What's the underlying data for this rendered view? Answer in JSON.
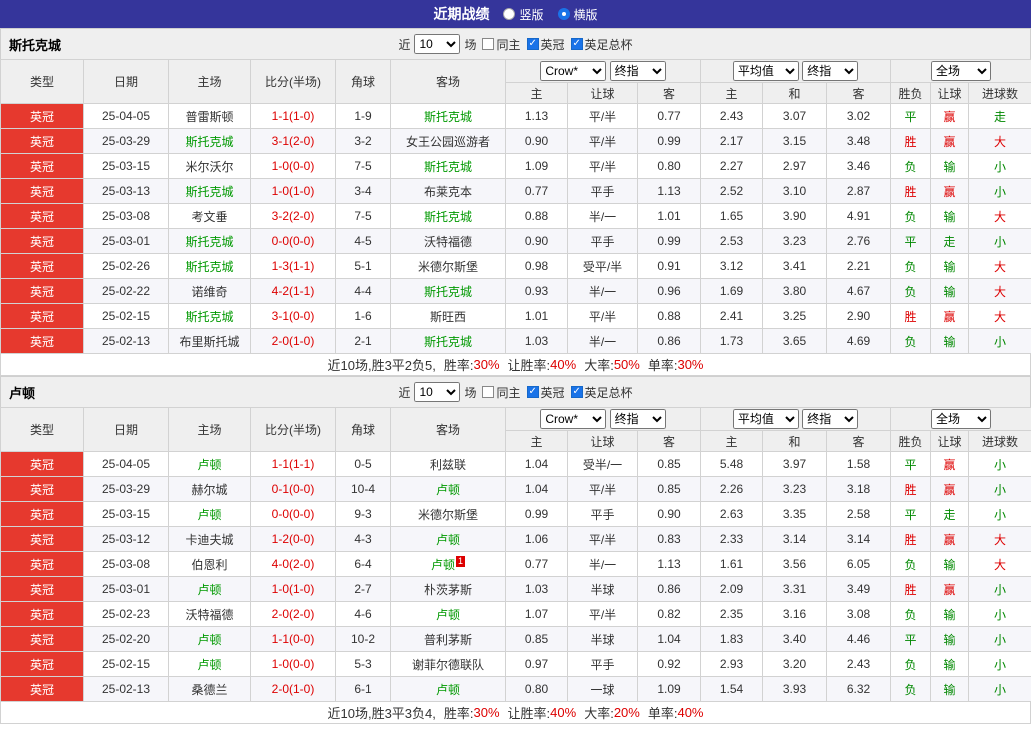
{
  "topbar": {
    "title": "近期战绩",
    "view_modes": [
      {
        "label": "竖版",
        "selected": false
      },
      {
        "label": "横版",
        "selected": true
      }
    ]
  },
  "columns": {
    "left": [
      "类型",
      "日期",
      "主场",
      "比分(半场)",
      "角球",
      "客场"
    ],
    "group1": {
      "bookmaker": "Crow*",
      "stage": "终指"
    },
    "group2": {
      "bookmaker": "平均值",
      "stage": "终指"
    },
    "group3": {
      "scope": "全场"
    },
    "sub": [
      "主",
      "让球",
      "客",
      "主",
      "和",
      "客",
      "胜负",
      "让球",
      "进球数"
    ]
  },
  "outcome_colors": {
    "胜": "red",
    "平": "green",
    "负": "green",
    "赢": "red",
    "输": "green",
    "走": "green",
    "大": "red",
    "小": "green"
  },
  "colors": {
    "red": "#dd0000",
    "green": "#008800",
    "badge_bg": "#e6392e",
    "topbar_bg": "#35359b",
    "accent_blue": "#1a73e8"
  },
  "sections": [
    {
      "team": "斯托克城",
      "controls": {
        "recent_label": "近",
        "count": "10",
        "unit_label": "场",
        "filters": [
          {
            "label": "同主",
            "checked": false
          },
          {
            "label": "英冠",
            "checked": true
          },
          {
            "label": "英足总杯",
            "checked": true
          }
        ]
      },
      "rows": [
        {
          "league": "英冠",
          "date": "25-04-05",
          "home": "普雷斯顿",
          "home_target": false,
          "score": "1-1(1-0)",
          "corners": "1-9",
          "away": "斯托克城",
          "away_target": true,
          "odds": [
            "1.13",
            "平/半",
            "0.77",
            "2.43",
            "3.07",
            "3.02"
          ],
          "results": [
            "平",
            "赢",
            "走"
          ]
        },
        {
          "league": "英冠",
          "date": "25-03-29",
          "home": "斯托克城",
          "home_target": true,
          "score": "3-1(2-0)",
          "corners": "3-2",
          "away": "女王公园巡游者",
          "away_target": false,
          "odds": [
            "0.90",
            "平/半",
            "0.99",
            "2.17",
            "3.15",
            "3.48"
          ],
          "results": [
            "胜",
            "赢",
            "大"
          ]
        },
        {
          "league": "英冠",
          "date": "25-03-15",
          "home": "米尔沃尔",
          "home_target": false,
          "score": "1-0(0-0)",
          "corners": "7-5",
          "away": "斯托克城",
          "away_target": true,
          "odds": [
            "1.09",
            "平/半",
            "0.80",
            "2.27",
            "2.97",
            "3.46"
          ],
          "results": [
            "负",
            "输",
            "小"
          ]
        },
        {
          "league": "英冠",
          "date": "25-03-13",
          "home": "斯托克城",
          "home_target": true,
          "score": "1-0(1-0)",
          "corners": "3-4",
          "away": "布莱克本",
          "away_target": false,
          "odds": [
            "0.77",
            "平手",
            "1.13",
            "2.52",
            "3.10",
            "2.87"
          ],
          "results": [
            "胜",
            "赢",
            "小"
          ]
        },
        {
          "league": "英冠",
          "date": "25-03-08",
          "home": "考文垂",
          "home_target": false,
          "score": "3-2(2-0)",
          "corners": "7-5",
          "away": "斯托克城",
          "away_target": true,
          "odds": [
            "0.88",
            "半/一",
            "1.01",
            "1.65",
            "3.90",
            "4.91"
          ],
          "results": [
            "负",
            "输",
            "大"
          ]
        },
        {
          "league": "英冠",
          "date": "25-03-01",
          "home": "斯托克城",
          "home_target": true,
          "score": "0-0(0-0)",
          "corners": "4-5",
          "away": "沃特福德",
          "away_target": false,
          "odds": [
            "0.90",
            "平手",
            "0.99",
            "2.53",
            "3.23",
            "2.76"
          ],
          "results": [
            "平",
            "走",
            "小"
          ]
        },
        {
          "league": "英冠",
          "date": "25-02-26",
          "home": "斯托克城",
          "home_target": true,
          "score": "1-3(1-1)",
          "corners": "5-1",
          "away": "米德尔斯堡",
          "away_target": false,
          "odds": [
            "0.98",
            "受平/半",
            "0.91",
            "3.12",
            "3.41",
            "2.21"
          ],
          "results": [
            "负",
            "输",
            "大"
          ]
        },
        {
          "league": "英冠",
          "date": "25-02-22",
          "home": "诺维奇",
          "home_target": false,
          "score": "4-2(1-1)",
          "corners": "4-4",
          "away": "斯托克城",
          "away_target": true,
          "odds": [
            "0.93",
            "半/一",
            "0.96",
            "1.69",
            "3.80",
            "4.67"
          ],
          "results": [
            "负",
            "输",
            "大"
          ]
        },
        {
          "league": "英冠",
          "date": "25-02-15",
          "home": "斯托克城",
          "home_target": true,
          "score": "3-1(0-0)",
          "corners": "1-6",
          "away": "斯旺西",
          "away_target": false,
          "odds": [
            "1.01",
            "平/半",
            "0.88",
            "2.41",
            "3.25",
            "2.90"
          ],
          "results": [
            "胜",
            "赢",
            "大"
          ]
        },
        {
          "league": "英冠",
          "date": "25-02-13",
          "home": "布里斯托城",
          "home_target": false,
          "score": "2-0(1-0)",
          "corners": "2-1",
          "away": "斯托克城",
          "away_target": true,
          "odds": [
            "1.03",
            "半/一",
            "0.86",
            "1.73",
            "3.65",
            "4.69"
          ],
          "results": [
            "负",
            "输",
            "小"
          ]
        }
      ],
      "summary": {
        "prefix": "近10场,胜3平2负5,",
        "stats": [
          {
            "label": "胜率:",
            "value": "30%"
          },
          {
            "label": "让胜率:",
            "value": "40%"
          },
          {
            "label": "大率:",
            "value": "50%"
          },
          {
            "label": "单率:",
            "value": "30%"
          }
        ]
      }
    },
    {
      "team": "卢顿",
      "controls": {
        "recent_label": "近",
        "count": "10",
        "unit_label": "场",
        "filters": [
          {
            "label": "同主",
            "checked": false
          },
          {
            "label": "英冠",
            "checked": true
          },
          {
            "label": "英足总杯",
            "checked": true
          }
        ]
      },
      "rows": [
        {
          "league": "英冠",
          "date": "25-04-05",
          "home": "卢顿",
          "home_target": true,
          "score": "1-1(1-1)",
          "corners": "0-5",
          "away": "利兹联",
          "away_target": false,
          "odds": [
            "1.04",
            "受半/一",
            "0.85",
            "5.48",
            "3.97",
            "1.58"
          ],
          "results": [
            "平",
            "赢",
            "小"
          ]
        },
        {
          "league": "英冠",
          "date": "25-03-29",
          "home": "赫尔城",
          "home_target": false,
          "score": "0-1(0-0)",
          "corners": "10-4",
          "away": "卢顿",
          "away_target": true,
          "odds": [
            "1.04",
            "平/半",
            "0.85",
            "2.26",
            "3.23",
            "3.18"
          ],
          "results": [
            "胜",
            "赢",
            "小"
          ]
        },
        {
          "league": "英冠",
          "date": "25-03-15",
          "home": "卢顿",
          "home_target": true,
          "score": "0-0(0-0)",
          "corners": "9-3",
          "away": "米德尔斯堡",
          "away_target": false,
          "odds": [
            "0.99",
            "平手",
            "0.90",
            "2.63",
            "3.35",
            "2.58"
          ],
          "results": [
            "平",
            "走",
            "小"
          ]
        },
        {
          "league": "英冠",
          "date": "25-03-12",
          "home": "卡迪夫城",
          "home_target": false,
          "score": "1-2(0-0)",
          "corners": "4-3",
          "away": "卢顿",
          "away_target": true,
          "odds": [
            "1.06",
            "平/半",
            "0.83",
            "2.33",
            "3.14",
            "3.14"
          ],
          "results": [
            "胜",
            "赢",
            "大"
          ]
        },
        {
          "league": "英冠",
          "date": "25-03-08",
          "home": "伯恩利",
          "home_target": false,
          "score": "4-0(2-0)",
          "corners": "6-4",
          "away": "卢顿",
          "away_target": true,
          "red_card": "1",
          "odds": [
            "0.77",
            "半/一",
            "1.13",
            "1.61",
            "3.56",
            "6.05"
          ],
          "results": [
            "负",
            "输",
            "大"
          ]
        },
        {
          "league": "英冠",
          "date": "25-03-01",
          "home": "卢顿",
          "home_target": true,
          "score": "1-0(1-0)",
          "corners": "2-7",
          "away": "朴茨茅斯",
          "away_target": false,
          "odds": [
            "1.03",
            "半球",
            "0.86",
            "2.09",
            "3.31",
            "3.49"
          ],
          "results": [
            "胜",
            "赢",
            "小"
          ]
        },
        {
          "league": "英冠",
          "date": "25-02-23",
          "home": "沃特福德",
          "home_target": false,
          "score": "2-0(2-0)",
          "corners": "4-6",
          "away": "卢顿",
          "away_target": true,
          "odds": [
            "1.07",
            "平/半",
            "0.82",
            "2.35",
            "3.16",
            "3.08"
          ],
          "results": [
            "负",
            "输",
            "小"
          ]
        },
        {
          "league": "英冠",
          "date": "25-02-20",
          "home": "卢顿",
          "home_target": true,
          "score": "1-1(0-0)",
          "corners": "10-2",
          "away": "普利茅斯",
          "away_target": false,
          "odds": [
            "0.85",
            "半球",
            "1.04",
            "1.83",
            "3.40",
            "4.46"
          ],
          "results": [
            "平",
            "输",
            "小"
          ]
        },
        {
          "league": "英冠",
          "date": "25-02-15",
          "home": "卢顿",
          "home_target": true,
          "score": "1-0(0-0)",
          "corners": "5-3",
          "away": "谢菲尔德联队",
          "away_target": false,
          "odds": [
            "0.97",
            "平手",
            "0.92",
            "2.93",
            "3.20",
            "2.43"
          ],
          "results": [
            "负",
            "输",
            "小"
          ]
        },
        {
          "league": "英冠",
          "date": "25-02-13",
          "home": "桑德兰",
          "home_target": false,
          "score": "2-0(1-0)",
          "corners": "6-1",
          "away": "卢顿",
          "away_target": true,
          "odds": [
            "0.80",
            "一球",
            "1.09",
            "1.54",
            "3.93",
            "6.32"
          ],
          "results": [
            "负",
            "输",
            "小"
          ]
        }
      ],
      "summary": {
        "prefix": "近10场,胜3平3负4,",
        "stats": [
          {
            "label": "胜率:",
            "value": "30%"
          },
          {
            "label": "让胜率:",
            "value": "40%"
          },
          {
            "label": "大率:",
            "value": "20%"
          },
          {
            "label": "单率:",
            "value": "40%"
          }
        ]
      }
    }
  ]
}
